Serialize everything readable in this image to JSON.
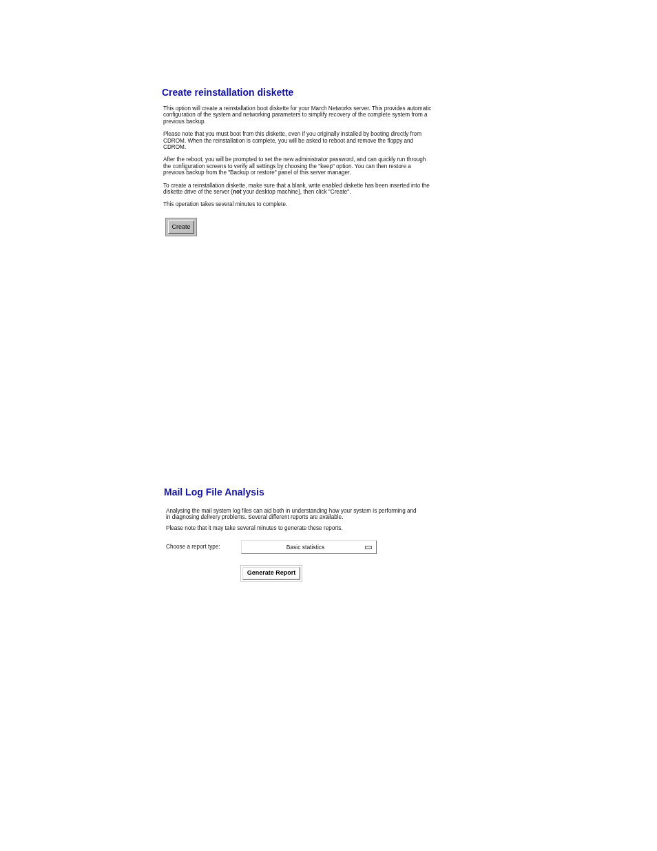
{
  "reinstall_diskette": {
    "title": "Create reinstallation diskette",
    "paragraphs": [
      "This option will create a reinstallation boot diskette for your March Networks server. This provides automatic configuration of the system and networking parameters to simplify recovery of the complete system from a previous backup.",
      "Please note that you must boot from this diskette, even if you originally installed by booting directly from CDROM. When the reinstallation is complete, you will be asked to reboot and remove the floppy and CDROM.",
      "After the reboot, you will be prompted to set the new administrator password, and can quickly run through the configuration screens to verify all settings by choosing the \"keep\" option. You can then restore a previous backup from the \"Backup or restore\" panel of this server manager.",
      "To create a reinstallation diskette, make sure that a blank, write enabled diskette has been inserted into the diskette drive of the server (**not** your desktop machine), then click \"Create\".",
      "This operation takes several minutes to complete."
    ],
    "button": "Create"
  },
  "mail_log_analysis": {
    "title": "Mail Log File Analysis",
    "paragraphs": [
      "Analysing the mail system log files can aid both in understanding how your system is performing and in diagnosing delivery problems. Several different reports are available.",
      "Please note that it may take several minutes to generate these reports."
    ],
    "report_type": {
      "label": "Choose a report type:",
      "value": "Basic statistics"
    },
    "button": "Generate Report"
  }
}
